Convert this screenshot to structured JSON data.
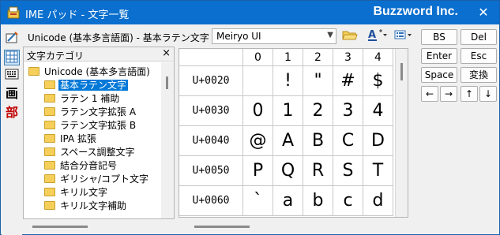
{
  "window": {
    "title": "IME パッド - 文字一覧",
    "brand": "Buzzword Inc.",
    "close_label": "✕"
  },
  "toolbar_left": {
    "buttons": [
      {
        "icon": "handwriting-icon"
      },
      {
        "icon": "char-list-icon",
        "selected": true
      },
      {
        "icon": "soft-keyboard-icon"
      },
      {
        "label": "画"
      },
      {
        "label": "部"
      }
    ]
  },
  "topbar": {
    "breadcrumb": "Unicode (基本多言語面) - 基本ラテン文字",
    "font_value": "Meiryo UI",
    "icons": [
      "open-folder-icon",
      "font-size-icon",
      "view-options-icon"
    ]
  },
  "category": {
    "title": "文字カテゴリ",
    "close_label": "×",
    "items": [
      {
        "label": "Unicode (基本多言語面)",
        "level": 0
      },
      {
        "label": "基本ラテン文字",
        "level": 1,
        "selected": true
      },
      {
        "label": "ラテン 1 補助",
        "level": 1
      },
      {
        "label": "ラテン文字拡張 A",
        "level": 1
      },
      {
        "label": "ラテン文字拡張 B",
        "level": 1
      },
      {
        "label": "IPA 拡張",
        "level": 1
      },
      {
        "label": "スペース調整文字",
        "level": 1
      },
      {
        "label": "結合分音記号",
        "level": 1
      },
      {
        "label": "ギリシャ/コプト文字",
        "level": 1
      },
      {
        "label": "キリル文字",
        "level": 1
      },
      {
        "label": "キリル文字補助",
        "level": 1
      }
    ]
  },
  "grid": {
    "columns": [
      "0",
      "1",
      "2",
      "3",
      "4"
    ],
    "rows": [
      {
        "code": "U+0020",
        "chars": [
          "",
          "!",
          "\"",
          "#",
          "$"
        ]
      },
      {
        "code": "U+0030",
        "chars": [
          "0",
          "1",
          "2",
          "3",
          "4"
        ]
      },
      {
        "code": "U+0040",
        "chars": [
          "@",
          "A",
          "B",
          "C",
          "D"
        ]
      },
      {
        "code": "U+0050",
        "chars": [
          "P",
          "Q",
          "R",
          "S",
          "T"
        ]
      },
      {
        "code": "U+0060",
        "chars": [
          "`",
          "a",
          "b",
          "c",
          "d"
        ]
      }
    ]
  },
  "keys": {
    "bs": "BS",
    "del": "Del",
    "enter": "Enter",
    "esc": "Esc",
    "space": "Space",
    "convert": "変換",
    "left": "←",
    "right": "→",
    "up": "↑",
    "down": "↓"
  }
}
